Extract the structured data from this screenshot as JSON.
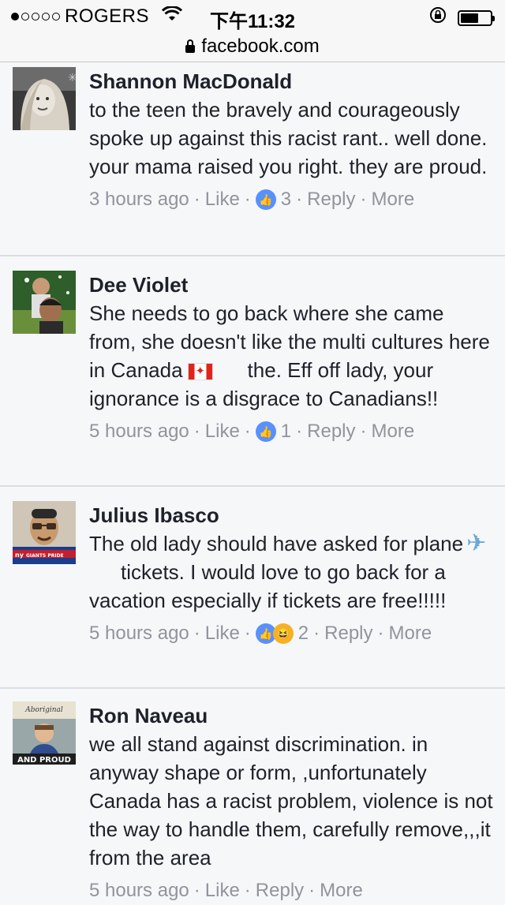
{
  "status_bar": {
    "carrier": "ROGERS",
    "time": "下午11:32"
  },
  "url_bar": {
    "domain": "facebook.com"
  },
  "comments": [
    {
      "author": "Shannon MacDonald",
      "text": "to the teen the bravely and courageously spoke up against this racist rant.. well done. your mama raised you right. they are proud.",
      "time": "3 hours ago",
      "like_label": "Like",
      "reaction_count": "3",
      "reply_label": "Reply",
      "more_label": "More"
    },
    {
      "author": "Dee Violet",
      "text_before_flag": "She needs to go back where she came from, she doesn't like the multi cultures here in Canada",
      "text_after_flag": "the. Eff off lady, your ignorance is a disgrace to Canadians!!",
      "time": "5 hours ago",
      "like_label": "Like",
      "reaction_count": "1",
      "reply_label": "Reply",
      "more_label": "More"
    },
    {
      "author": "Julius Ibasco",
      "text_before_plane": "The old lady should have asked for plane",
      "text_after_plane": "tickets. I would love to go back for a vacation especially if tickets are free!!!!!",
      "time": "5 hours ago",
      "like_label": "Like",
      "reaction_count": "2",
      "reply_label": "Reply",
      "more_label": "More"
    },
    {
      "author": "Ron Naveau",
      "text": "we all stand against discrimination. in anyway shape or form, ,unfortunately Canada has a racist problem, violence is not the way to handle them, carefully remove,,,it from the area",
      "time": "5 hours ago",
      "like_label": "Like",
      "reply_label": "Reply",
      "more_label": "More",
      "avatar_text_top": "Aboriginal",
      "avatar_text_bottom": "AND PROUD"
    }
  ],
  "avatar_badge_text": "GIANTS PRIDE",
  "avatar_badge_logo": "ny",
  "colors": {
    "reaction_like": "#5890ff",
    "meta_text": "#90949c",
    "background": "#f6f7f9"
  }
}
